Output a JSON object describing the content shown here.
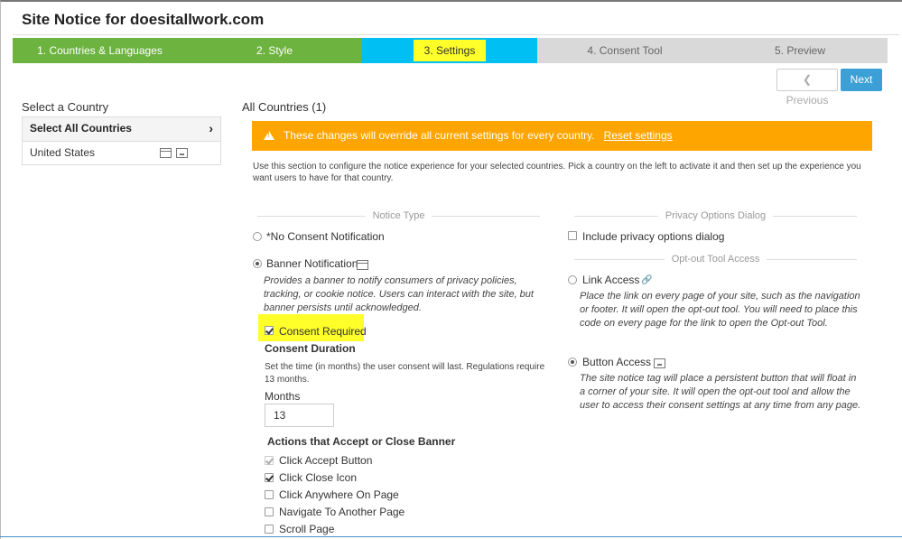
{
  "page": {
    "title": "Site Notice for doesitallwork.com"
  },
  "steps": [
    {
      "label": "1. Countries & Languages"
    },
    {
      "label": "2. Style"
    },
    {
      "label": "3. Settings"
    },
    {
      "label": "4. Consent Tool"
    },
    {
      "label": "5. Preview"
    }
  ],
  "nav": {
    "previous": "Previous",
    "next": "Next"
  },
  "countries": {
    "heading": "Select a Country",
    "items": [
      {
        "label": "Select All Countries"
      },
      {
        "label": "United States"
      }
    ]
  },
  "main": {
    "heading": "All Countries (1)",
    "warning": "These changes will override all current settings for every country.",
    "reset_link": "Reset settings",
    "description": "Use this section to configure the notice experience for your selected countries. Pick a country on the left to activate it and then set up the experience you want users to have for that country."
  },
  "notice_type": {
    "section_label": "Notice Type",
    "no_consent": "*No Consent Notification",
    "banner": "Banner Notification",
    "banner_desc": "Provides a banner to notify consumers of privacy policies, tracking, or cookie notice. Users can interact with the site, but banner persists until acknowledged.",
    "consent_required": "Consent Required",
    "consent_duration_title": "Consent Duration",
    "consent_duration_desc": "Set the time (in months) the user consent will last. Regulations require 13 months.",
    "months_label": "Months",
    "months_value": "13",
    "actions_title": "Actions that Accept or Close Banner",
    "actions": [
      {
        "label": "Click Accept Button",
        "checked": true,
        "disabled": true
      },
      {
        "label": "Click Close Icon",
        "checked": true,
        "disabled": false
      },
      {
        "label": "Click Anywhere On Page",
        "checked": false,
        "disabled": false
      },
      {
        "label": "Navigate To Another Page",
        "checked": false,
        "disabled": false
      },
      {
        "label": "Scroll Page",
        "checked": false,
        "disabled": false
      }
    ]
  },
  "privacy_dialog": {
    "section_label": "Privacy Options Dialog",
    "include": "Include privacy options dialog"
  },
  "optout": {
    "section_label": "Opt-out Tool Access",
    "link_access": "Link Access",
    "link_desc": "Place the link on every page of your site, such as the navigation or footer. It will open the opt-out tool. You will need to place this code on every page for the link to open the Opt-out Tool.",
    "button_access": "Button Access",
    "button_desc": "The site notice tag will place a persistent button that will float in a corner of your site. It will open the opt-out tool and allow the user to access their consent settings at any time from any page."
  },
  "colors": {
    "step_done": "#6cb33f",
    "step_active": "#00bff3",
    "step_todo": "#d9d9d9",
    "highlight": "#ffff2a",
    "warning": "#ffa500",
    "primary_button": "#3c9fd6"
  }
}
